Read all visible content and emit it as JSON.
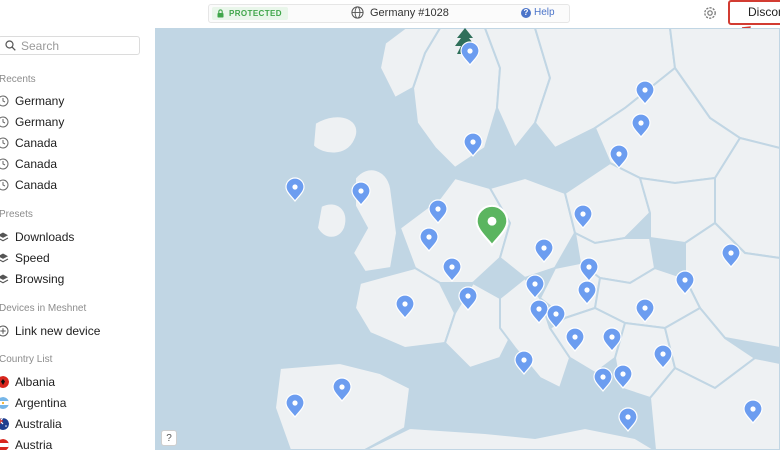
{
  "topbar": {
    "status": "PROTECTED",
    "status_color": "#3fa64a",
    "server": "Germany #1028",
    "help": "Help",
    "disconnect": "Disconnect"
  },
  "icons": {
    "lock": "lock-icon",
    "globe": "globe-icon",
    "help": "help-icon",
    "settings": "settings-icon",
    "search": "search-icon",
    "recent": "clock-icon",
    "preset": "layers-icon",
    "meshnet": "plus-circle-icon"
  },
  "sidebar": {
    "search_placeholder": "Search",
    "recents_title": "Recents",
    "recents": [
      "Germany",
      "Germany",
      "Canada",
      "Canada",
      "Canada"
    ],
    "presets_title": "Presets",
    "presets": [
      "Downloads",
      "Speed",
      "Browsing"
    ],
    "meshnet_title": "Devices in Meshnet",
    "meshnet_link": "Link new device",
    "countries_title": "Country List",
    "countries": [
      "Albania",
      "Argentina",
      "Australia",
      "Austria"
    ]
  },
  "map": {
    "help_button": "?",
    "connected_country": "Germany",
    "pin_color": "#6c9df0",
    "active_pin_color": "#5bb560",
    "land_color": "#eef1f3",
    "water_color": "#c1d6e4",
    "highlight_color": "#d23c32"
  }
}
